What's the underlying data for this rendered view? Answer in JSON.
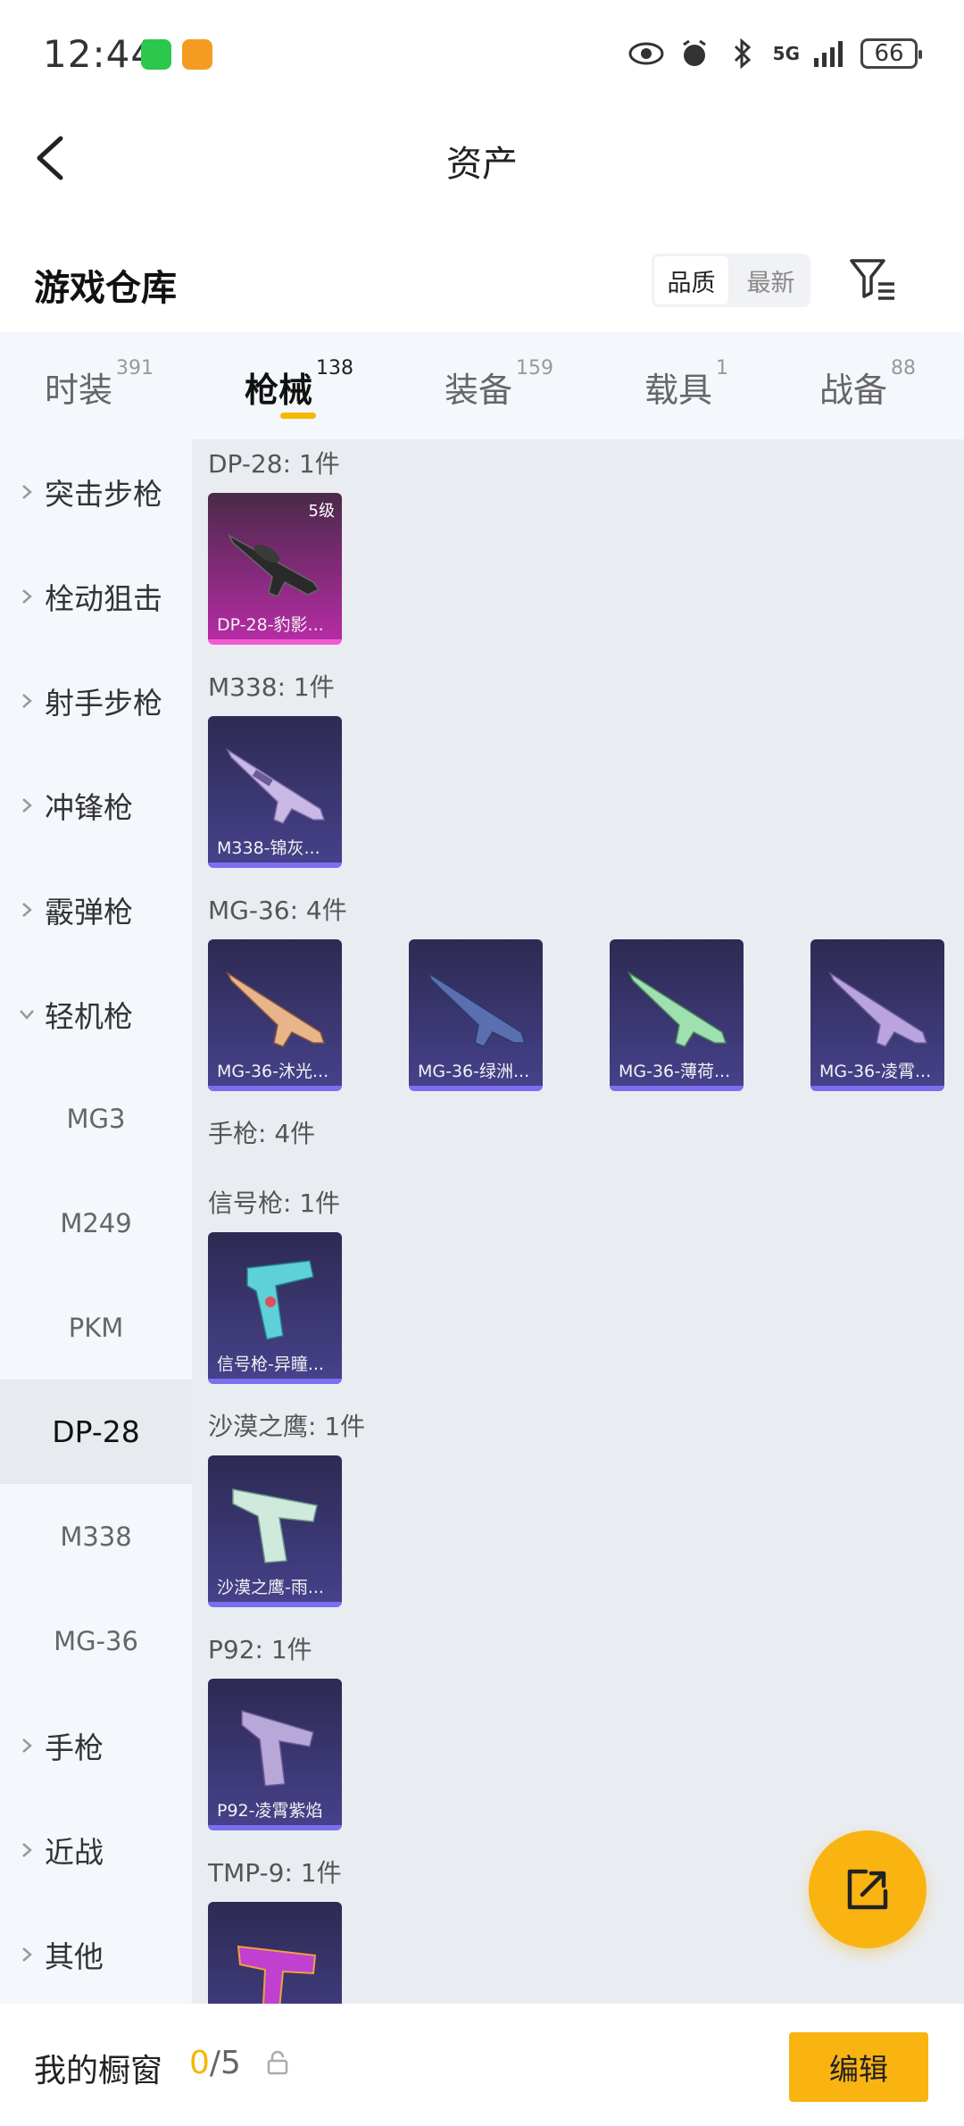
{
  "status_bar": {
    "time": "12:44",
    "network": "5G",
    "battery": "66"
  },
  "header": {
    "title": "资产"
  },
  "warehouse": {
    "title": "游戏仓库",
    "sort_options": [
      "品质",
      "最新"
    ],
    "active_sort": "品质"
  },
  "tabs": [
    {
      "label": "时装",
      "count": "391"
    },
    {
      "label": "枪械",
      "count": "138"
    },
    {
      "label": "装备",
      "count": "159"
    },
    {
      "label": "载具",
      "count": "1"
    },
    {
      "label": "战备",
      "count": "88"
    }
  ],
  "active_tab": "枪械",
  "sidebar": {
    "groups": [
      {
        "label": "突击步枪"
      },
      {
        "label": "栓动狙击"
      },
      {
        "label": "射手步枪"
      },
      {
        "label": "冲锋枪"
      },
      {
        "label": "霰弹枪"
      },
      {
        "label": "轻机枪"
      }
    ],
    "sub_items": [
      "MG3",
      "M249",
      "PKM",
      "DP-28",
      "M338",
      "MG-36"
    ],
    "selected_sub": "DP-28",
    "tail_groups": [
      {
        "label": "手枪"
      },
      {
        "label": "近战"
      },
      {
        "label": "其他"
      }
    ]
  },
  "sections": [
    {
      "title": "DP-28: 1件",
      "items": [
        {
          "label": "DP-28-豹影...",
          "badge": "5级",
          "rarity": "pink"
        }
      ]
    },
    {
      "title": "M338: 1件",
      "items": [
        {
          "label": "M338-锦灰..."
        }
      ]
    },
    {
      "title": "MG-36: 4件",
      "items": [
        {
          "label": "MG-36-沐光..."
        },
        {
          "label": "MG-36-绿洲..."
        },
        {
          "label": "MG-36-薄荷..."
        },
        {
          "label": "MG-36-凌霄..."
        }
      ]
    },
    {
      "title": "手枪: 4件",
      "items": []
    },
    {
      "title": "信号枪: 1件",
      "items": [
        {
          "label": "信号枪-异瞳..."
        }
      ]
    },
    {
      "title": "沙漠之鹰: 1件",
      "items": [
        {
          "label": "沙漠之鹰-雨..."
        }
      ]
    },
    {
      "title": "P92: 1件",
      "items": [
        {
          "label": "P92-凌霄紫焰"
        }
      ]
    },
    {
      "title": "TMP-9: 1件",
      "items": [
        {
          "label": ""
        }
      ]
    }
  ],
  "bottom_bar": {
    "title": "我的橱窗",
    "count_current": "0",
    "count_total": "/5",
    "edit_label": "编辑"
  },
  "colors": {
    "accent": "#f9b412",
    "tab_underline": "#f5b800",
    "card_common": "#46418a",
    "card_epic": "#b52ba4"
  }
}
